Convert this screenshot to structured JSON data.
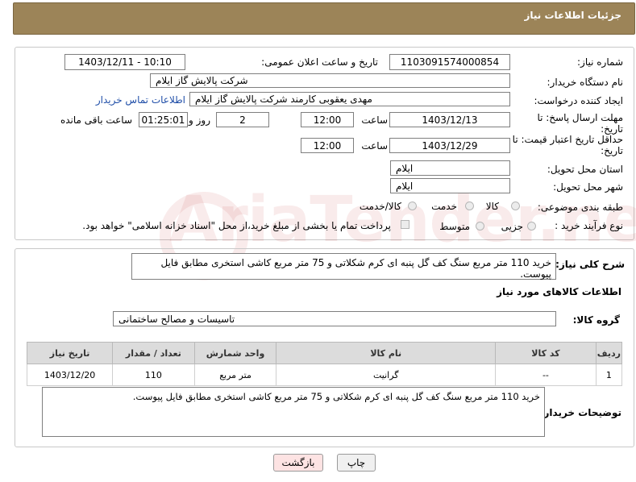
{
  "header": {
    "title": "جزئیات اطلاعات نیاز"
  },
  "form": {
    "need_number_label": "شماره نیاز:",
    "need_number": "1103091574000854",
    "announce_label": "تاریخ و ساعت اعلان عمومی:",
    "announce_value": "1403/12/11 - 10:10",
    "buyer_org_label": "نام دستگاه خریدار:",
    "buyer_org": "شرکت پالایش گاز ایلام",
    "creator_label": "ایجاد کننده درخواست:",
    "creator": "مهدی یعقوبی کارمند شرکت پالایش گاز ایلام",
    "contact_link": "اطلاعات تماس خریدار",
    "deadline_label": "مهلت ارسال پاسخ: تا تاریخ:",
    "deadline_date": "1403/12/13",
    "time_label": "ساعت",
    "deadline_time": "12:00",
    "days_value": "2",
    "days_label": "روز و",
    "remaining_time": "01:25:01",
    "remaining_label": "ساعت باقی مانده",
    "validity_label": "حداقل تاریخ اعتبار قیمت: تا تاریخ:",
    "validity_date": "1403/12/29",
    "validity_time": "12:00",
    "province_label": "استان محل تحویل:",
    "province": "ایلام",
    "city_label": "شهر محل تحویل:",
    "city": "ایلام",
    "category_label": "طبقه بندی موضوعی:",
    "category_options": [
      "کالا",
      "خدمت",
      "کالا/خدمت"
    ],
    "process_label": "نوع فرآیند خرید :",
    "process_options": [
      "جزیی",
      "متوسط"
    ],
    "payment_note": "پرداخت تمام یا بخشی از مبلغ خرید،از محل \"اسناد خزانه اسلامی\" خواهد بود."
  },
  "details": {
    "description_label": "شرح کلی نیاز:",
    "description": "خرید 110 متر مربع سنگ کف گل پنبه ای کرم شکلاتی و 75 متر مربع کاشی استخری مطابق فایل پیوست.",
    "goods_info_title": "اطلاعات کالاهای مورد نیاز",
    "goods_group_label": "گروه کالا:",
    "goods_group": "تاسیسات و مصالح ساختمانی",
    "table": {
      "headers": [
        "ردیف",
        "کد کالا",
        "نام کالا",
        "واحد شمارش",
        "تعداد / مقدار",
        "تاریخ نیاز"
      ],
      "rows": [
        [
          "1",
          "--",
          "گرانیت",
          "متر مربع",
          "110",
          "1403/12/20"
        ]
      ]
    },
    "buyer_notes_label": "توضیحات خریدار:",
    "buyer_notes": "خرید 110 متر مربع سنگ کف گل پنبه ای کرم شکلاتی و 75 متر مربع کاشی استخری مطابق فایل پیوست."
  },
  "buttons": {
    "print": "چاپ",
    "back": "بازگشت"
  },
  "watermark": "AriaTender.neT"
}
